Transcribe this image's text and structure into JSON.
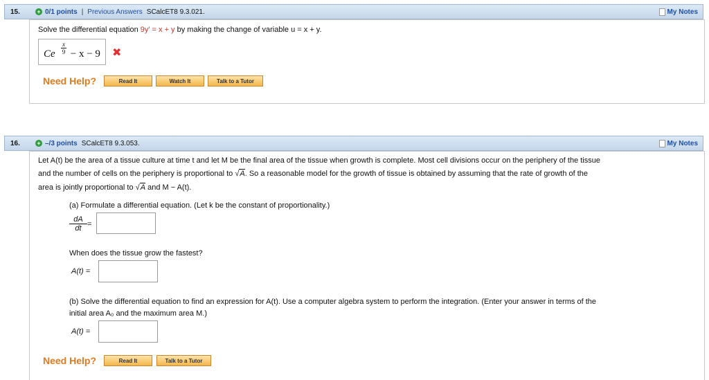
{
  "q15": {
    "number": "15.",
    "points": "0/1 points",
    "separator": "|",
    "previous_answers": "Previous Answers",
    "code": "SCalcET8 9.3.021.",
    "my_notes": "My Notes",
    "prompt_pre": "Solve the differential equation ",
    "equation": "9y′ = x + y",
    "prompt_post": " by making the change of variable u = x + y.",
    "answer_C": "Ce",
    "answer_exp_num": "x",
    "answer_exp_den": "9",
    "answer_rest": " − x − 9",
    "need_help": "Need Help?",
    "btn_read": "Read It",
    "btn_watch": "Watch It",
    "btn_tutor": "Talk to a Tutor"
  },
  "q16": {
    "number": "16.",
    "points": "–/3 points",
    "code": "SCalcET8 9.3.053.",
    "my_notes": "My Notes",
    "para1": "Let A(t) be the area of a tissue culture at time t and let M be the final area of the tissue when growth is complete. Most cell divisions occur on the periphery of the tissue",
    "para2a": "and the number of cells on the periphery is proportional to ",
    "para2_sqrt": "A",
    "para2b": ". So a reasonable model for the growth of tissue is obtained by assuming that the rate of growth of the",
    "para3a": "area is jointly proportional to ",
    "para3_sqrt": "A",
    "para3b": " and M − A(t).",
    "part_a": "(a) Formulate a differential equation. (Let k be the constant of proportionality.)",
    "frac_num": "dA",
    "frac_den": "dt",
    "equals": "=",
    "fastest_q": "When does the tissue grow the fastest?",
    "at_label": "A(t) =",
    "part_b1": "(b) Solve the differential equation to find an expression for A(t). Use a computer algebra system to perform the integration. (Enter your answer in terms of the",
    "part_b2": "initial area A₀ and the maximum area M.)",
    "at_label2": "A(t) =",
    "need_help": "Need Help?",
    "btn_read": "Read It",
    "btn_tutor": "Talk to a Tutor"
  }
}
